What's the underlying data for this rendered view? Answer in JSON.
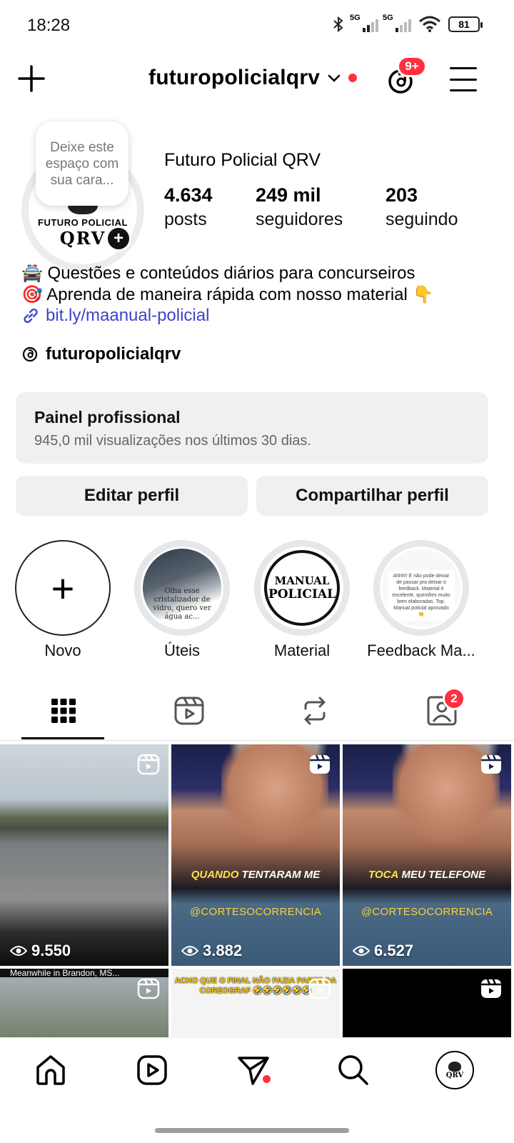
{
  "status_bar": {
    "time": "18:28",
    "network1": "5G",
    "network2": "5G",
    "battery": "81"
  },
  "header": {
    "username": "futuropolicialqrv",
    "notif_badge": "9+"
  },
  "profile": {
    "note": "Deixe este espaço com sua cara...",
    "avatar_text1": "FUTURO POLICIAL",
    "avatar_text2": "QRV",
    "display_name": "Futuro Policial QRV",
    "stats": [
      {
        "value": "4.634",
        "label": "posts"
      },
      {
        "value": "249 mil",
        "label": "seguidores"
      },
      {
        "value": "203",
        "label": "seguindo"
      }
    ],
    "bio_line1": "🚔 Questões e conteúdos diários para concurseiros",
    "bio_line2": "🎯 Aprenda de maneira rápida com nosso material 👇",
    "link": "bit.ly/maanual-policial",
    "threads_handle": "futuropolicialqrv"
  },
  "pro_panel": {
    "title": "Painel profissional",
    "subtitle": "945,0 mil visualizações nos últimos 30 dias."
  },
  "buttons": {
    "edit": "Editar perfil",
    "share": "Compartilhar perfil"
  },
  "highlights": [
    {
      "label": "Novo",
      "icon": "plus-icon"
    },
    {
      "label": "Úteis",
      "caption": "Olha esse cristalizador de vidro, quero ver água ac..."
    },
    {
      "label": "Material",
      "line1": "MANUAL",
      "line2": "POLICIAL"
    },
    {
      "label": "Feedback Ma...",
      "preview": "Ahhh!! E não pode deixar de passar pra deixar o feedback. Material é excelente, questões muito bem elaboradas. Top. Manual policial aprovado 👏"
    }
  ],
  "tabs": {
    "tagged_badge": "2"
  },
  "posts": [
    {
      "views": "9.550"
    },
    {
      "views": "3.882",
      "caption_a": "QUANDO",
      "caption_b": " TENTARAM ME",
      "handle": "@CORTESOCORRENCIA"
    },
    {
      "views": "6.527",
      "caption_a": "TOCA",
      "caption_b": " MEU TELEFONE",
      "handle": "@CORTESOCORRENCIA"
    },
    {
      "top_caption": "Meanwhile in Brandon, MS..."
    },
    {
      "caption": "ACHO QUE O FINAL NÃO FAZIA PARTE DA COREOGRAF 🤣🤣🤣🤣🤣🤣"
    },
    {}
  ],
  "nav": {
    "avatar_text": "QRV"
  },
  "colors": {
    "accent_red": "#ff2f40",
    "link_blue": "#3a44c9",
    "panel_gray": "#eff0f2"
  }
}
